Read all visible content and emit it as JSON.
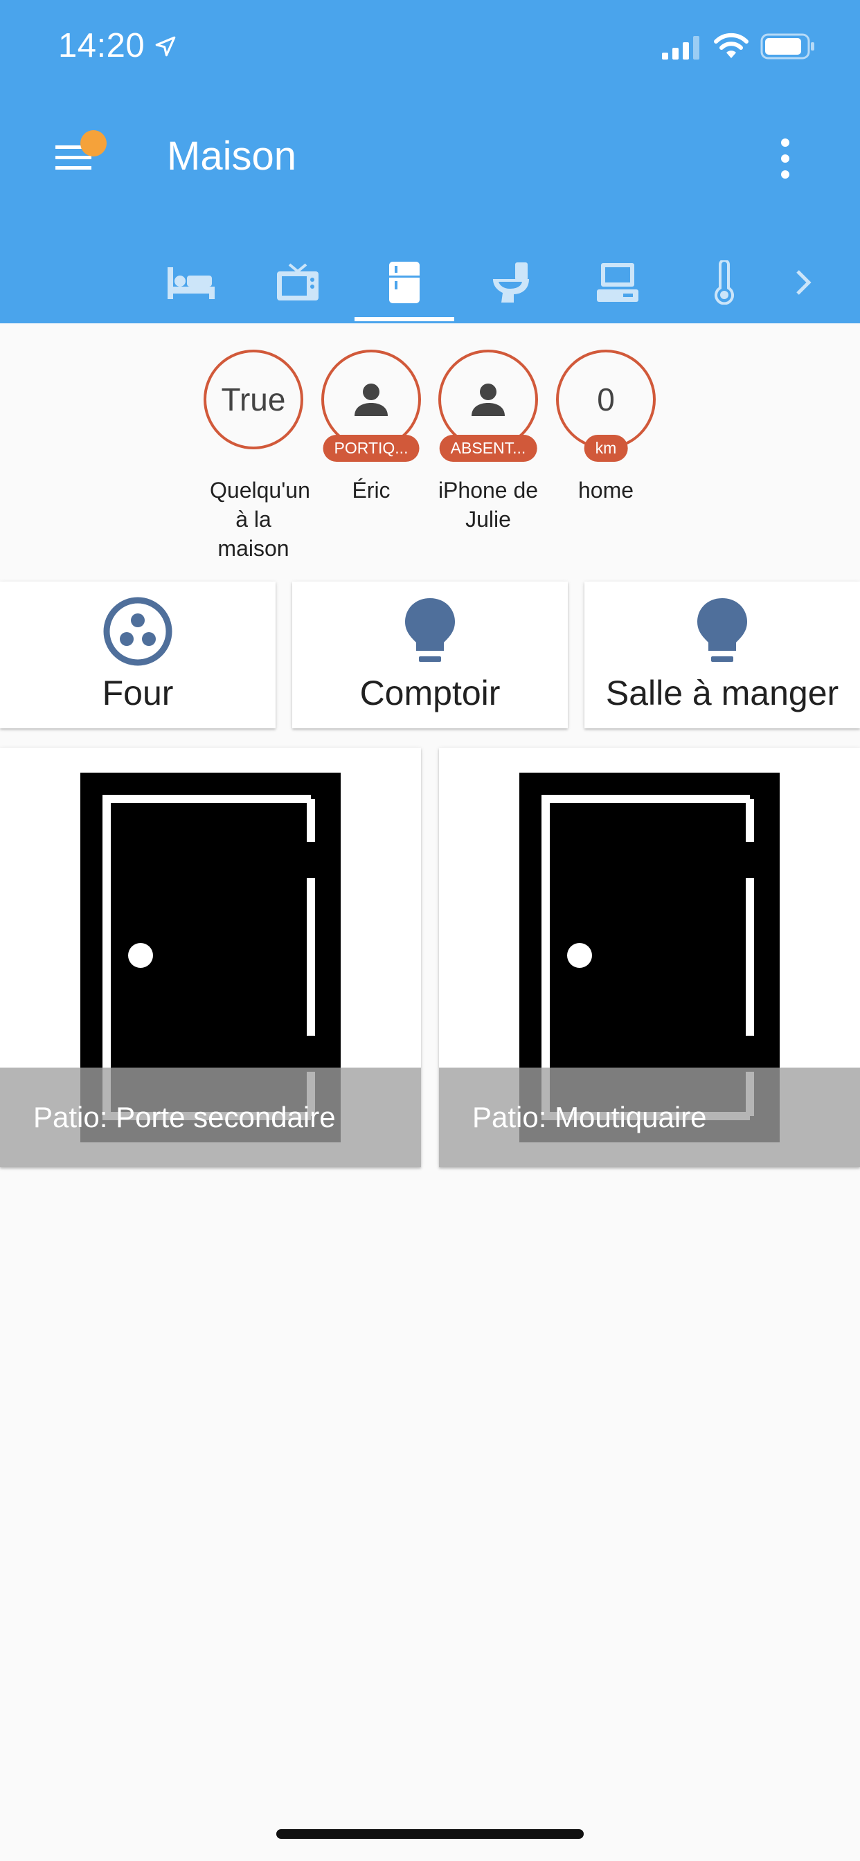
{
  "status_bar": {
    "time": "14:20"
  },
  "header": {
    "title": "Maison"
  },
  "tabs": [
    {
      "icon": "bed-icon"
    },
    {
      "icon": "tv-icon"
    },
    {
      "icon": "fridge-icon",
      "active": true
    },
    {
      "icon": "toilet-icon"
    },
    {
      "icon": "laptop-icon"
    },
    {
      "icon": "thermometer-icon"
    }
  ],
  "badges": [
    {
      "value": "True",
      "label": "",
      "name": "Quelqu'un à la maison"
    },
    {
      "value": "",
      "label": "PORTIQ...",
      "name": "Éric"
    },
    {
      "value": "",
      "label": "ABSENT...",
      "name": "iPhone de Julie"
    },
    {
      "value": "0",
      "label": "km",
      "name": "home"
    }
  ],
  "entity_buttons": [
    {
      "label": "Four",
      "icon": "stove-burners-icon"
    },
    {
      "label": "Comptoir",
      "icon": "lightbulb-icon"
    },
    {
      "label": "Salle à manger",
      "icon": "lightbulb-icon"
    }
  ],
  "picture_cards": [
    {
      "caption": "Patio: Porte secondaire",
      "icon": "door-icon"
    },
    {
      "caption": "Patio: Moutiquaire",
      "icon": "door-icon"
    }
  ],
  "colors": {
    "appbar": "#4aa4ec",
    "accent": "#d1593a",
    "icon_blue": "#4f6f9b",
    "notification_dot": "#f5a23a"
  }
}
